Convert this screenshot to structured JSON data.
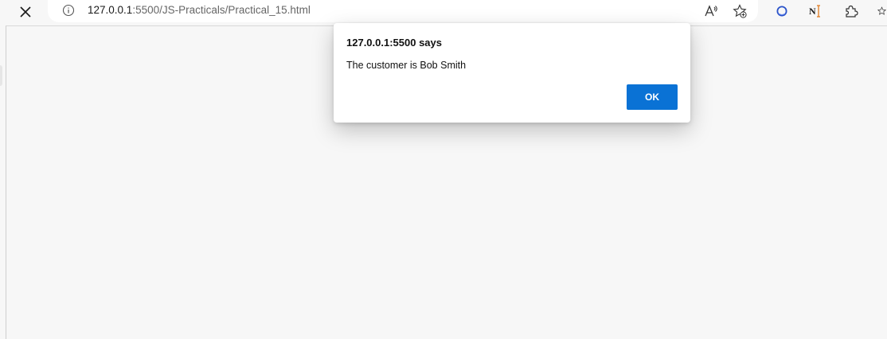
{
  "browser": {
    "url_host": "127.0.0.1",
    "url_rest": ":5500/JS-Practicals/Practical_15.html",
    "read_aloud_icon": "read-aloud-icon",
    "favorite_icon": "add-favorite-icon",
    "extensions": [
      "copilot-extension-icon",
      "ni-extension-icon",
      "extensions-puzzle-icon",
      "favorites-icon"
    ]
  },
  "dialog": {
    "title": "127.0.0.1:5500 says",
    "message": "The customer is Bob Smith",
    "ok_label": "OK"
  },
  "colors": {
    "ok_button": "#0a72d5",
    "page_background": "#f7f7f7"
  }
}
